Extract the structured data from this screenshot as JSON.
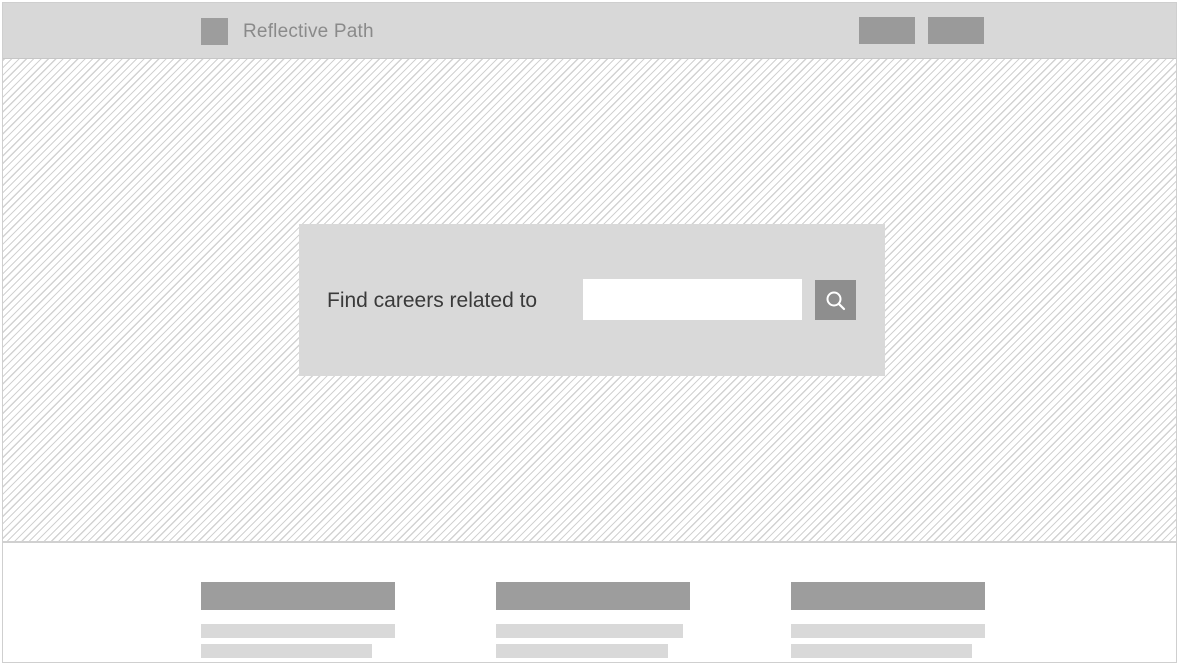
{
  "header": {
    "brand": "Reflective Path",
    "logo_icon": "logo-placeholder",
    "nav": [
      {
        "label": ""
      },
      {
        "label": ""
      }
    ]
  },
  "hero": {
    "search": {
      "label": "Find careers related to",
      "value": "",
      "placeholder": "",
      "button_icon": "search-icon"
    }
  },
  "content": {
    "cards": [
      {
        "title": "",
        "lines": [
          "",
          ""
        ]
      },
      {
        "title": "",
        "lines": [
          "",
          ""
        ]
      },
      {
        "title": "",
        "lines": [
          "",
          ""
        ]
      }
    ]
  },
  "colors": {
    "header_bg": "#d8d8d8",
    "placeholder_dark": "#9d9d9d",
    "placeholder_light": "#d9d9d9",
    "search_button": "#8e8e8e",
    "text": "#3a3a3a",
    "brand_text": "#8a8a8a"
  }
}
